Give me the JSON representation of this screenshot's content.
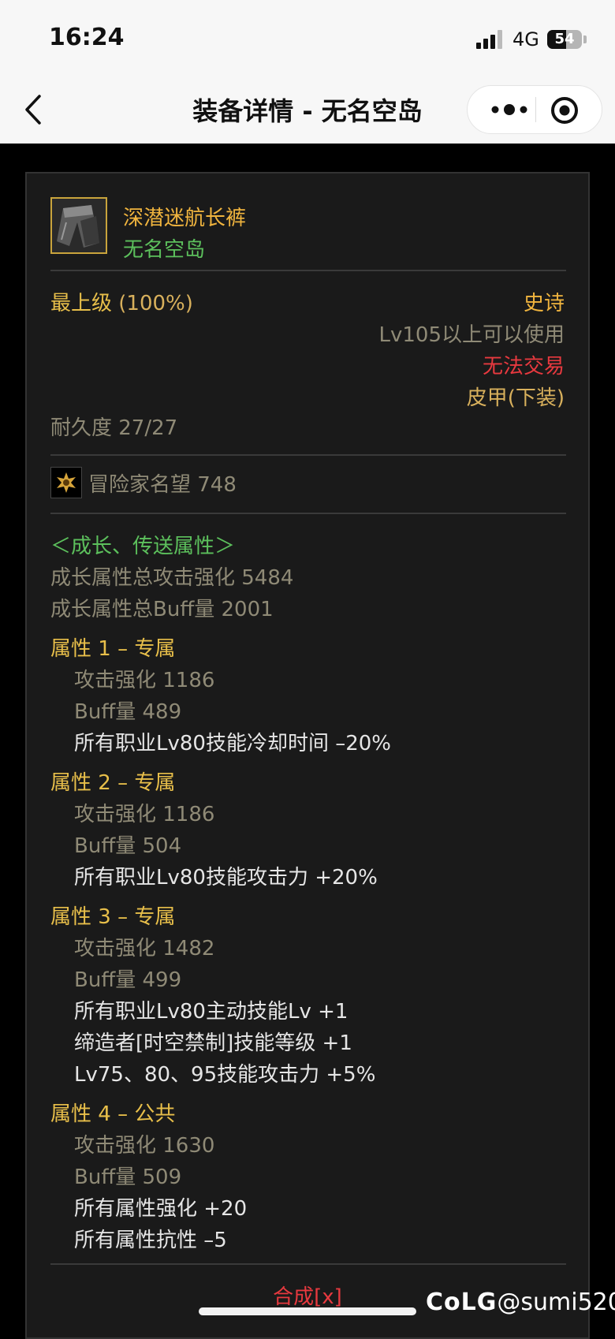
{
  "status_bar": {
    "time": "16:24",
    "network": "4G",
    "battery": "54",
    "battery_level": 0.54
  },
  "nav": {
    "title": "装备详情 - 无名空岛",
    "more_icon": "more-dots-icon",
    "close_icon": "target-close-icon"
  },
  "item": {
    "name": "深潜迷航长裤",
    "set_name": "无名空岛",
    "grade": "最上级",
    "grade_percent": "(100%)",
    "rarity": "史诗",
    "level_req": "Lv105以上可以使用",
    "trade": "无法交易",
    "type": "皮甲(下装)",
    "durability": "耐久度 27/27",
    "fame": "冒险家名望 748"
  },
  "growth": {
    "header": "＜成长、传送属性＞",
    "total_attack": "成长属性总攻击强化 5484",
    "total_buff": "成长属性总Buff量 2001"
  },
  "attributes": [
    {
      "title": "属性 1 – 专属",
      "attack": "攻击强化   1186",
      "buff": "Buff量   489",
      "effects": [
        "所有职业Lv80技能冷却时间 –20%"
      ]
    },
    {
      "title": "属性 2 – 专属",
      "attack": "攻击强化   1186",
      "buff": "Buff量   504",
      "effects": [
        "所有职业Lv80技能攻击力 +20%"
      ]
    },
    {
      "title": "属性 3 – 专属",
      "attack": "攻击强化   1482",
      "buff": "Buff量   499",
      "effects": [
        "所有职业Lv80主动技能Lv +1",
        "缔造者[时空禁制]技能等级 +1",
        "Lv75、80、95技能攻击力 +5%"
      ]
    },
    {
      "title": "属性 4 – 公共",
      "attack": "攻击强化   1630",
      "buff": "Buff量   509",
      "effects": [
        "所有属性强化 +20",
        "所有属性抗性 –5"
      ]
    }
  ],
  "footer": {
    "synthesis": "合成[x]"
  },
  "watermark": {
    "brand": "CoLG",
    "user": "@sumi520"
  },
  "colors": {
    "gold": "#e8bf4a",
    "epic": "#f0b43e",
    "set_green": "#5cc05c",
    "untradable_red": "#e8393f",
    "grey": "#8f8a76",
    "white": "#e6e6e6"
  }
}
